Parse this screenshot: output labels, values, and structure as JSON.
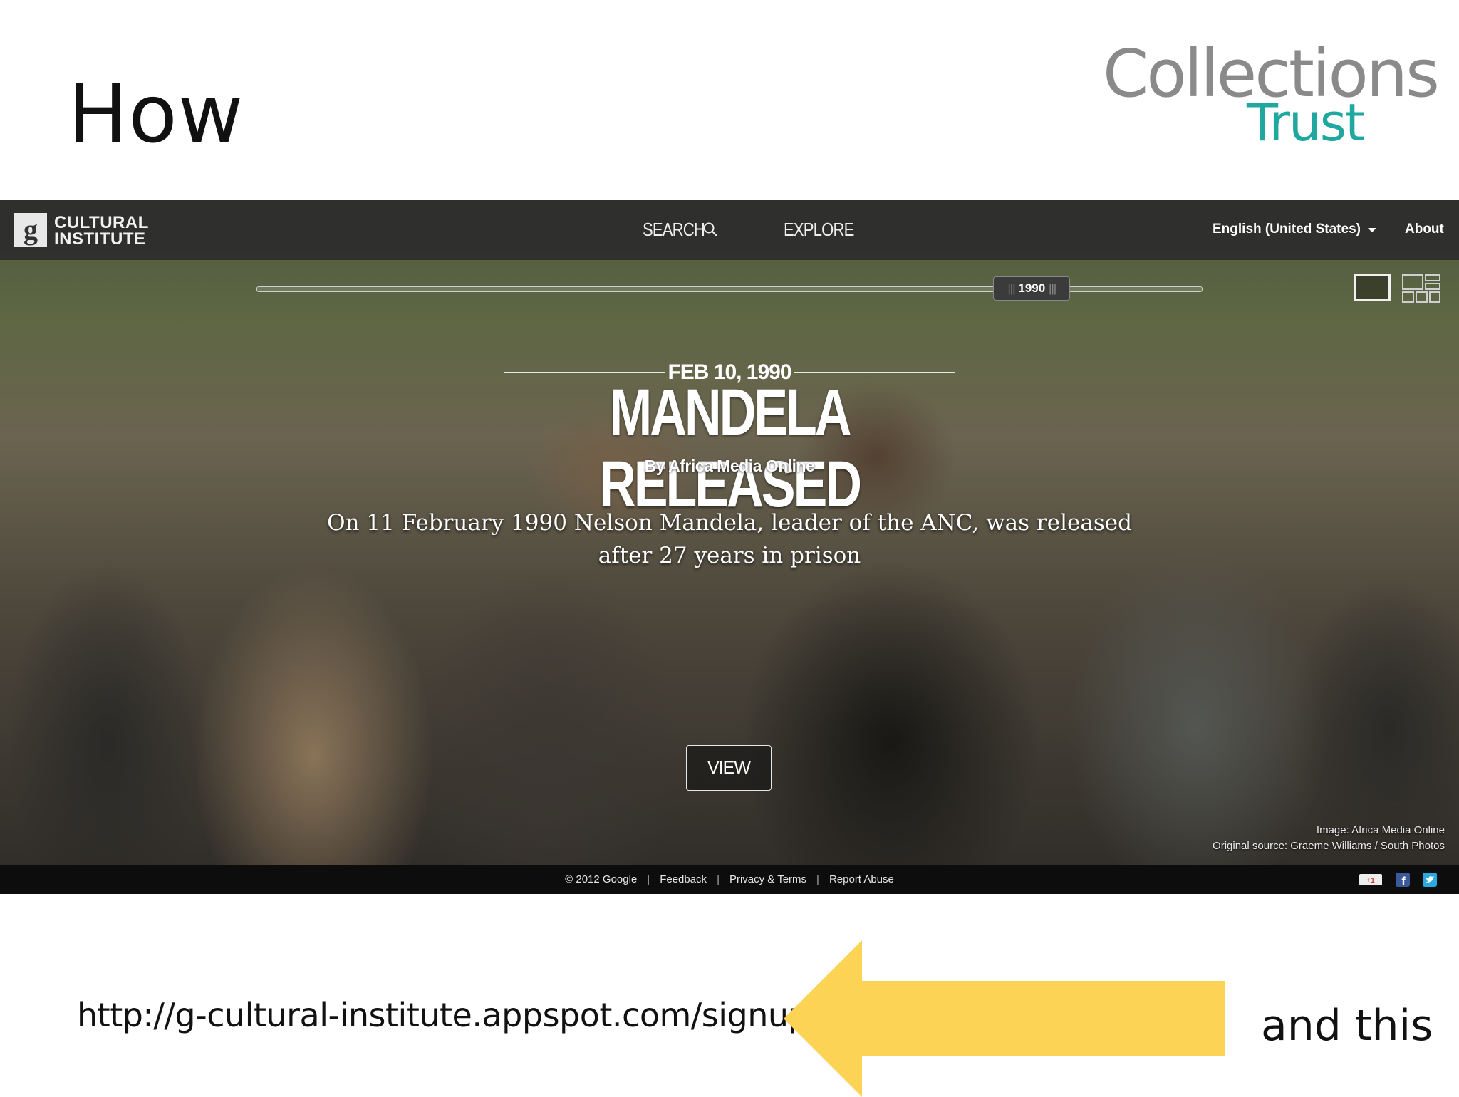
{
  "slide": {
    "title": "How",
    "logo_line1": "Collections",
    "logo_line2": "Trust",
    "url_text": "http://g-cultural-institute.appspot.com/signup",
    "callout": "and this",
    "arrow_color": "#fdd355"
  },
  "site": {
    "logo_line1": "CULTURAL",
    "logo_line2": "INSTITUTE",
    "nav": {
      "search": "SEARCH",
      "explore": "EXPLORE"
    },
    "language": "English (United States)",
    "about": "About",
    "timeline": {
      "year": "1990",
      "position": 0.82
    },
    "exhibit": {
      "date": "FEB 10, 1990",
      "title": "MANDELA RELEASED",
      "byline": "By Africa Media Online",
      "description": "On 11 February 1990 Nelson Mandela, leader of the ANC, was released after 27 years in prison",
      "view_label": "VIEW"
    },
    "credit": {
      "line1": "Image: Africa Media Online",
      "line2": "Original source: Graeme Williams / South Photos"
    },
    "footer": {
      "copyright": "© 2012 Google",
      "feedback": "Feedback",
      "privacy": "Privacy & Terms",
      "report": "Report Abuse"
    },
    "social_icons": [
      "google-plus-icon",
      "facebook-icon",
      "twitter-icon"
    ]
  }
}
